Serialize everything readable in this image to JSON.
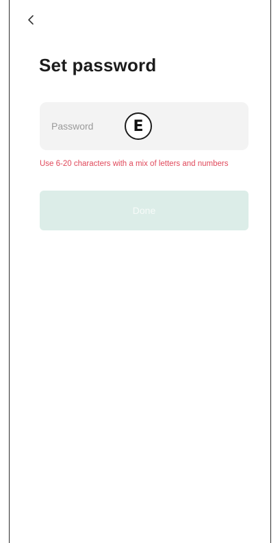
{
  "header": {
    "back_icon": "chevron-left-icon"
  },
  "page": {
    "title": "Set password"
  },
  "password_field": {
    "placeholder": "Password",
    "value": ""
  },
  "annotation": {
    "label": "E"
  },
  "hint": {
    "text": "Use 6-20 characters with a mix of letters and numbers",
    "color": "#e0485a"
  },
  "done_button": {
    "label": "Done",
    "state": "disabled",
    "color": "#dcede8"
  }
}
